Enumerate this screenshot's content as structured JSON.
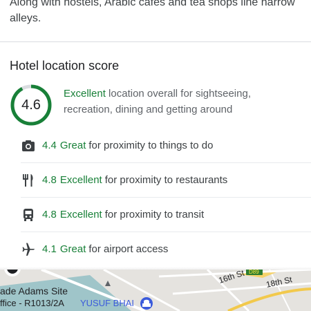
{
  "intro": {
    "text": "Along with hostels, Arabic cafes and tea shops line narrow alleys."
  },
  "location_score": {
    "title": "Hotel location score",
    "overall": {
      "score": "4.6",
      "score_fraction": 0.92,
      "rating": "Excellent",
      "description": "location overall for sightseeing, recreation, dining and getting around"
    },
    "categories": [
      {
        "icon": "camera-icon",
        "score": "4.4",
        "rating": "Great",
        "text": "for proximity to things to do"
      },
      {
        "icon": "restaurant-icon",
        "score": "4.8",
        "rating": "Excellent",
        "text": "for proximity to restaurants"
      },
      {
        "icon": "transit-icon",
        "score": "4.8",
        "rating": "Excellent",
        "text": "for proximity to transit"
      },
      {
        "icon": "airplane-icon",
        "score": "4.1",
        "rating": "Great",
        "text": "for airport access"
      }
    ]
  },
  "map": {
    "labels": {
      "site": "ade Adams Site",
      "office": "ffice - R1013/2A",
      "place": "YUSUF BHAI",
      "street1": "16th St",
      "street2": "18th St",
      "road_badge": "D89"
    }
  },
  "colors": {
    "accent_green": "#188038",
    "ring_track": "#dadce0"
  }
}
